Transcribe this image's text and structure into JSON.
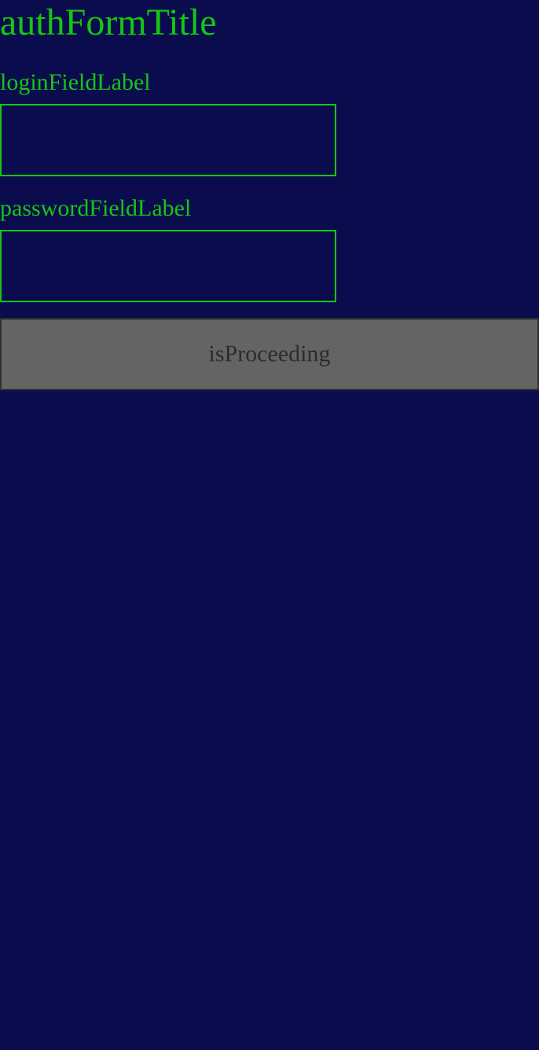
{
  "form": {
    "title": "authFormTitle",
    "login": {
      "label": "loginFieldLabel",
      "value": "",
      "placeholder": ""
    },
    "password": {
      "label": "passwordFieldLabel",
      "value": "",
      "placeholder": ""
    },
    "submit_label": "isProceeding",
    "submit_disabled": true
  },
  "colors": {
    "background": "#0b0c4d",
    "accent": "#14c714",
    "button_background": "#646464",
    "button_text": "#2c2c2c"
  }
}
